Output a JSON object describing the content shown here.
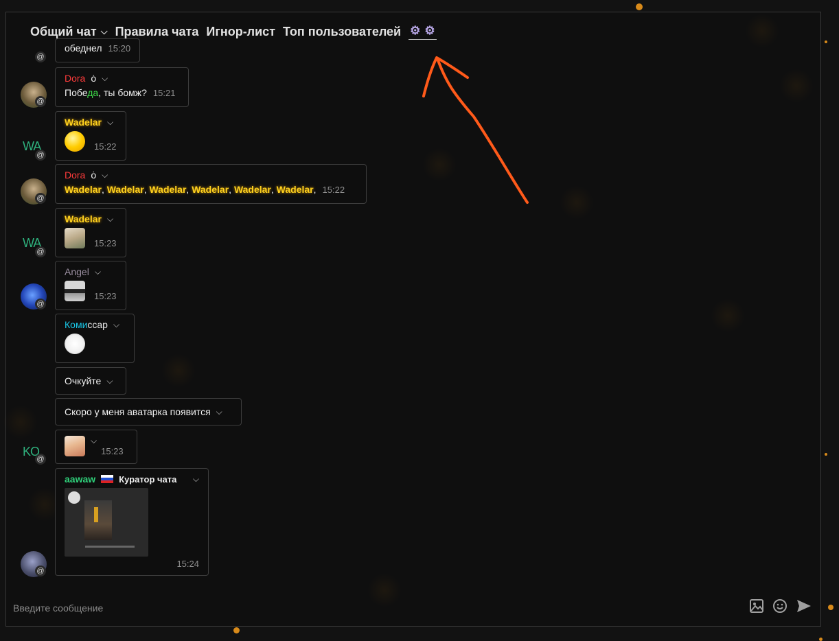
{
  "nav": {
    "items": [
      {
        "label": "Общий чат",
        "has_dropdown": true
      },
      {
        "label": "Правила чата"
      },
      {
        "label": "Игнор-лист"
      },
      {
        "label": "Топ пользователей"
      }
    ],
    "settings_icons": [
      "gear-icon",
      "gear-icon"
    ]
  },
  "messages": [
    {
      "author": "",
      "text": "обеднел",
      "time": "15:20"
    },
    {
      "author": "Dora",
      "badge": "ȯ",
      "text_a": "Побе",
      "text_b": "да",
      "text_c": ", ты бомж?",
      "time": "15:21"
    },
    {
      "author": "Wadelar",
      "avatar_text": "WA",
      "sticker": "laughing-face",
      "time": "15:22"
    },
    {
      "author": "Dora",
      "badge": "ȯ",
      "mentions": [
        "Wadelar",
        "Wadelar",
        "Wadelar",
        "Wadelar",
        "Wadelar",
        "Wadelar"
      ],
      "time": "15:22"
    },
    {
      "author": "Wadelar",
      "avatar_text": "WA",
      "sticker": "monkey",
      "time": "15:23"
    },
    {
      "author": "Angel",
      "sticker": "sunglasses-cat",
      "time": "15:23"
    },
    {
      "author_a": "Коми",
      "author_b": "ссар",
      "sticker": "white-face"
    },
    {
      "text": "Очкуйте"
    },
    {
      "text": "Скоро у меня аватарка появится"
    },
    {
      "avatar_text": "KO",
      "sticker": "cat",
      "time": "15:23"
    },
    {
      "author": "aawaw",
      "flag": "russia-flag",
      "role": "Куратор чата",
      "attachment": "screenshot-image",
      "time": "15:24"
    }
  ],
  "input": {
    "placeholder": "Введите сообщение",
    "icons": [
      "image-icon",
      "smile-icon",
      "send-icon"
    ]
  },
  "colors": {
    "accent_orange": "#ff5a1a",
    "dora": "#ff3b3b",
    "wadelar": "#ffd21f",
    "komissar": "#19c6e6",
    "aawaw": "#2fd07a"
  }
}
